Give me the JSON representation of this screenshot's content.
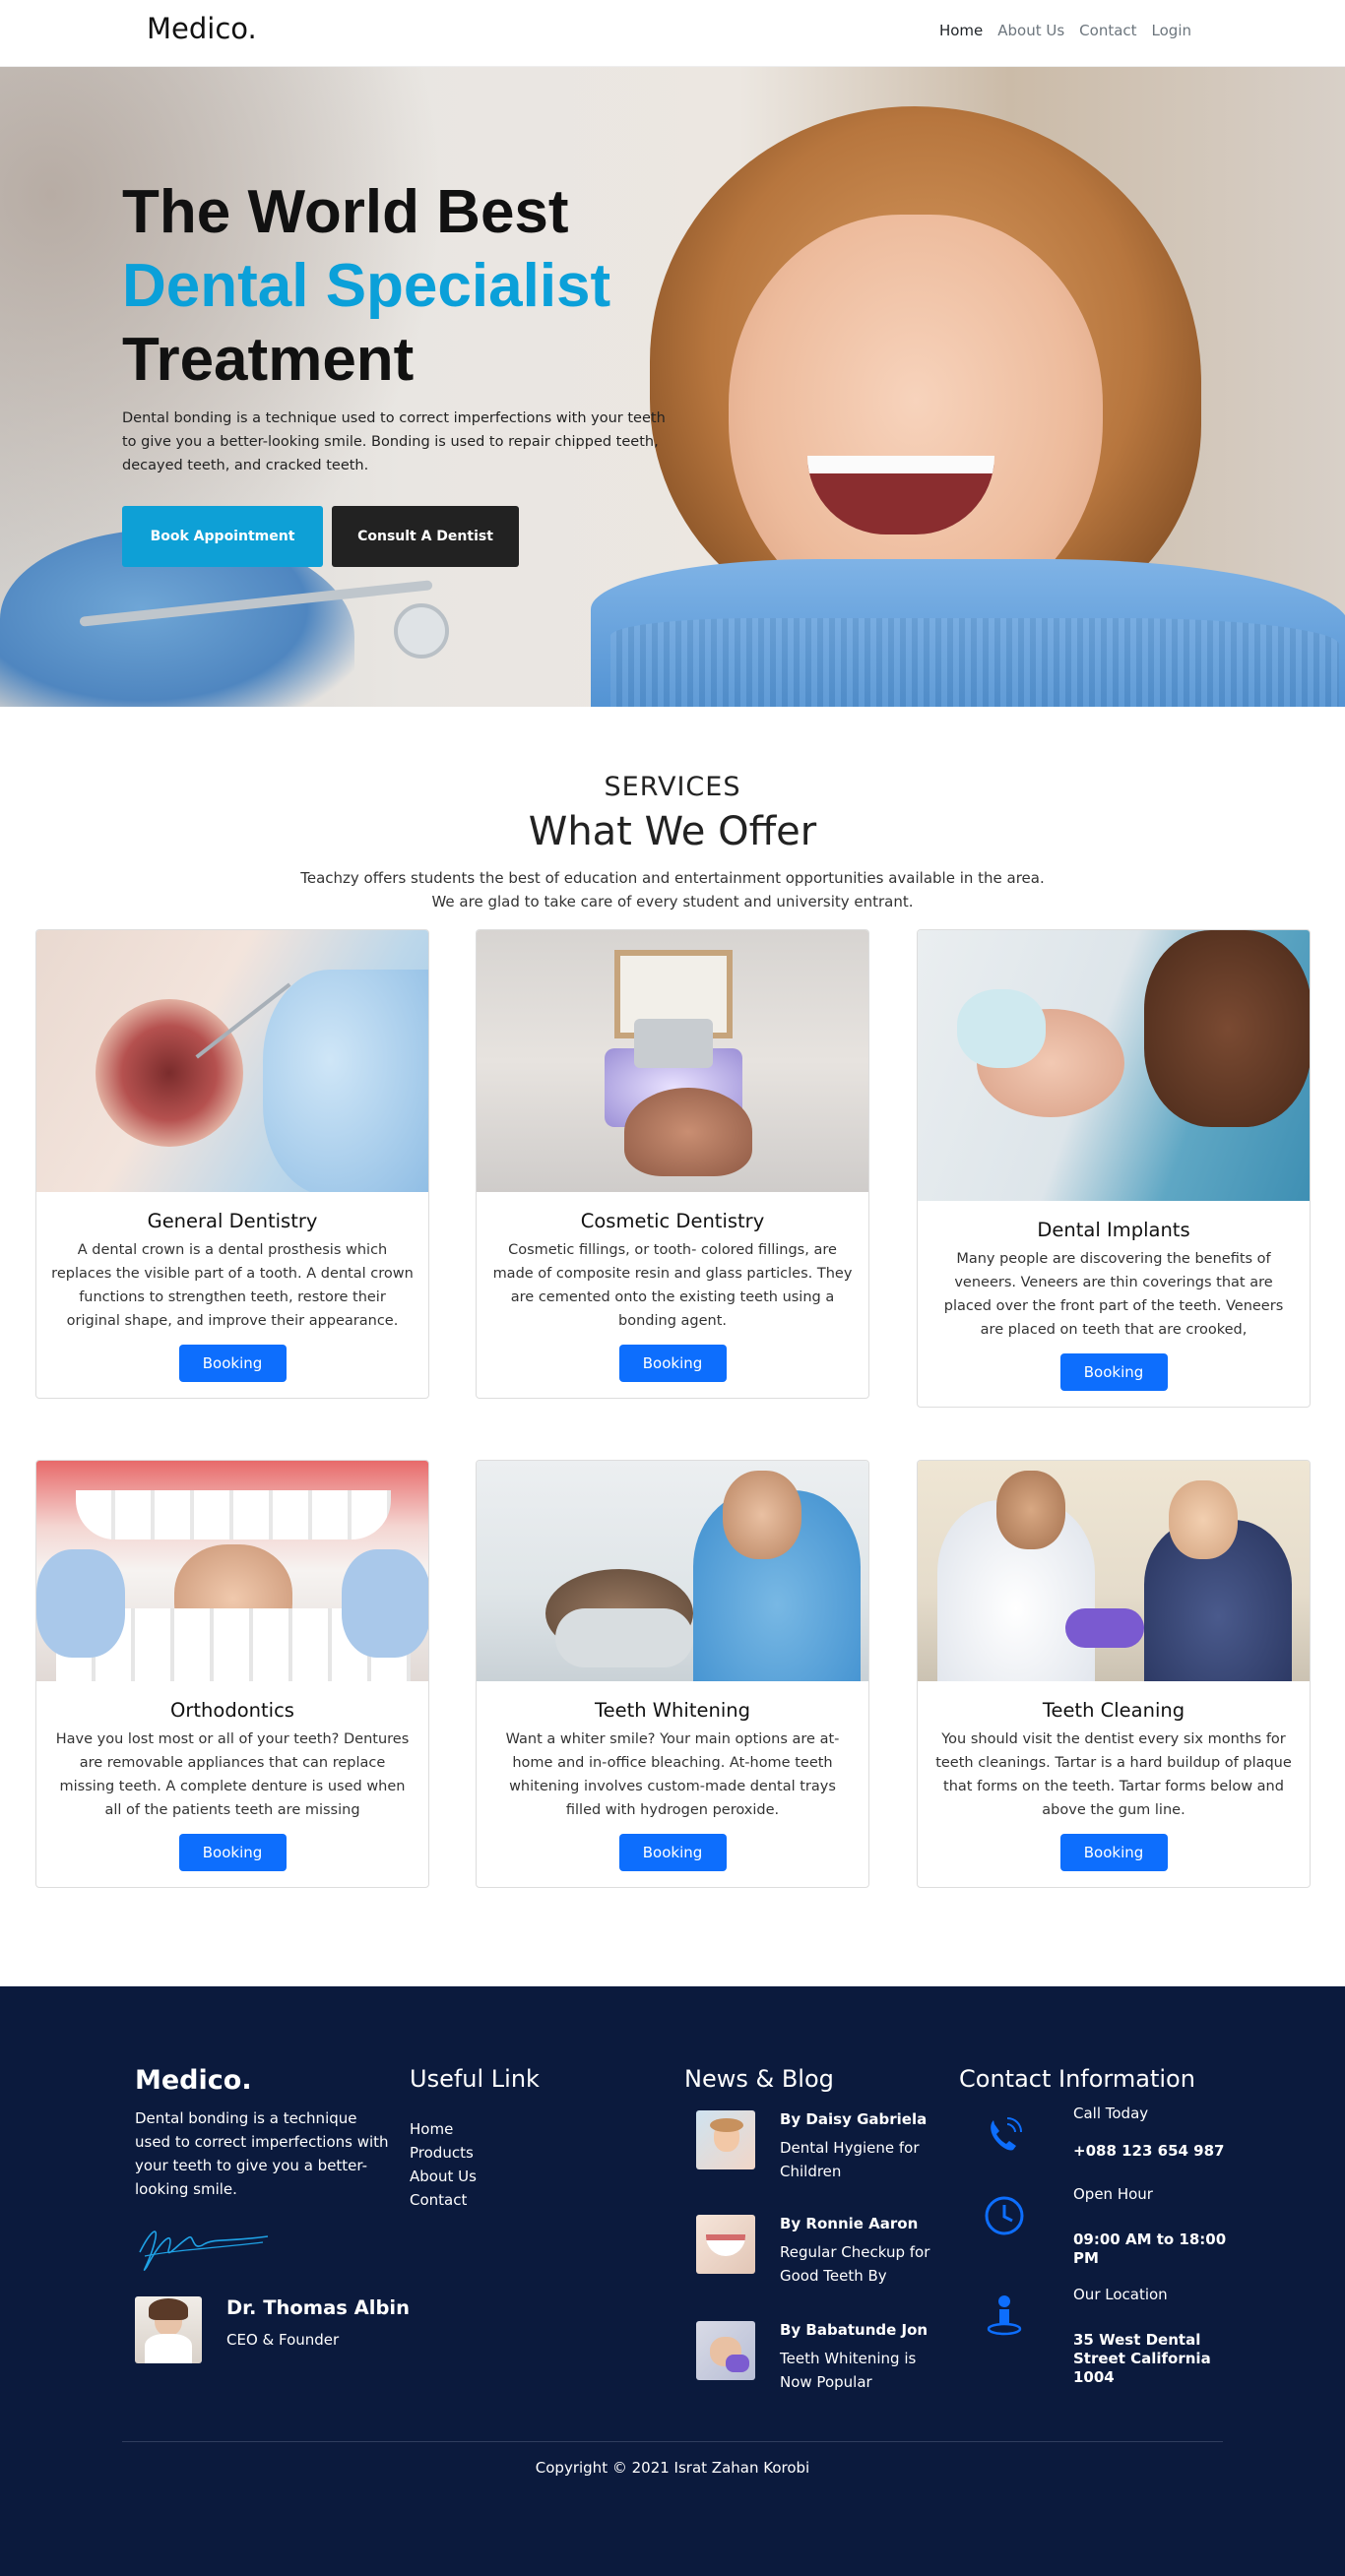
{
  "nav": {
    "logo": "Medico.",
    "links": [
      "Home",
      "About Us",
      "Contact",
      "Login"
    ]
  },
  "hero": {
    "line1": "The World Best",
    "line2": "Dental Specialist",
    "line3": "Treatment",
    "description": "Dental bonding is a technique used to correct imperfections with your teeth to give you a better-looking smile. Bonding is used to repair chipped teeth, decayed teeth, and cracked teeth.",
    "btn_primary": "Book Appointment",
    "btn_secondary": "Consult A Dentist"
  },
  "services": {
    "kicker": "SERVICES",
    "title": "What We Offer",
    "sub1": "Teachzy offers students the best of education and entertainment opportunities available in the area.",
    "sub2": "We are glad to take care of every student and university entrant.",
    "booking_label": "Booking",
    "cards": [
      {
        "title": "General Dentistry",
        "text": "A dental crown is a dental prosthesis which replaces the visible part of a tooth. A dental crown functions to strengthen teeth, restore their original shape, and improve their appearance."
      },
      {
        "title": "Cosmetic Dentistry",
        "text": "Cosmetic fillings, or tooth- colored fillings, are made of composite resin and glass particles. They are cemented onto the existing teeth using a bonding agent."
      },
      {
        "title": "Dental Implants",
        "text": "Many people are discovering the benefits of veneers. Veneers are thin coverings that are placed over the front part of the teeth. Veneers are placed on teeth that are crooked,"
      },
      {
        "title": "Orthodontics",
        "text": "Have you lost most or all of your teeth? Dentures are removable appliances that can replace missing teeth. A complete denture is used when all of the patients teeth are missing"
      },
      {
        "title": "Teeth Whitening",
        "text": "Want a whiter smile? Your main options are at-home and in-office bleaching. At-home teeth whitening involves custom-made dental trays filled with hydrogen peroxide."
      },
      {
        "title": "Teeth Cleaning",
        "text": "You should visit the dentist every six months for teeth cleanings. Tartar is a hard buildup of plaque that forms on the teeth. Tartar forms below and above the gum line."
      }
    ]
  },
  "footer": {
    "logo": "Medico.",
    "description": "Dental bonding is a technique used to correct imperfections with your teeth to give you a better-looking smile.",
    "doctor_name": "Dr. Thomas Albin",
    "doctor_role": "CEO & Founder",
    "useful_heading": "Useful Link",
    "useful_links": [
      "Home",
      "Products",
      "About Us",
      "Contact"
    ],
    "blog_heading": "News & Blog",
    "blog": [
      {
        "by": "By Daisy Gabriela",
        "title": "Dental Hygiene for Children"
      },
      {
        "by": "By Ronnie Aaron",
        "title": "Regular Checkup for Good Teeth By"
      },
      {
        "by": "By Babatunde Jon",
        "title": "Teeth Whitening is Now Popular"
      }
    ],
    "contact_heading": "Contact Information",
    "contacts": [
      {
        "label": "Call Today",
        "value": "+088 123 654 987",
        "icon": "phone-icon"
      },
      {
        "label": "Open Hour",
        "value": "09:00 AM to 18:00 PM",
        "icon": "clock-icon"
      },
      {
        "label": "Our Location",
        "value": "35 West Dental Street California 1004",
        "icon": "location-icon"
      }
    ],
    "copyright": "Copyright © 2021 Israt Zahan Korobi",
    "accent": "#0d6efd"
  }
}
